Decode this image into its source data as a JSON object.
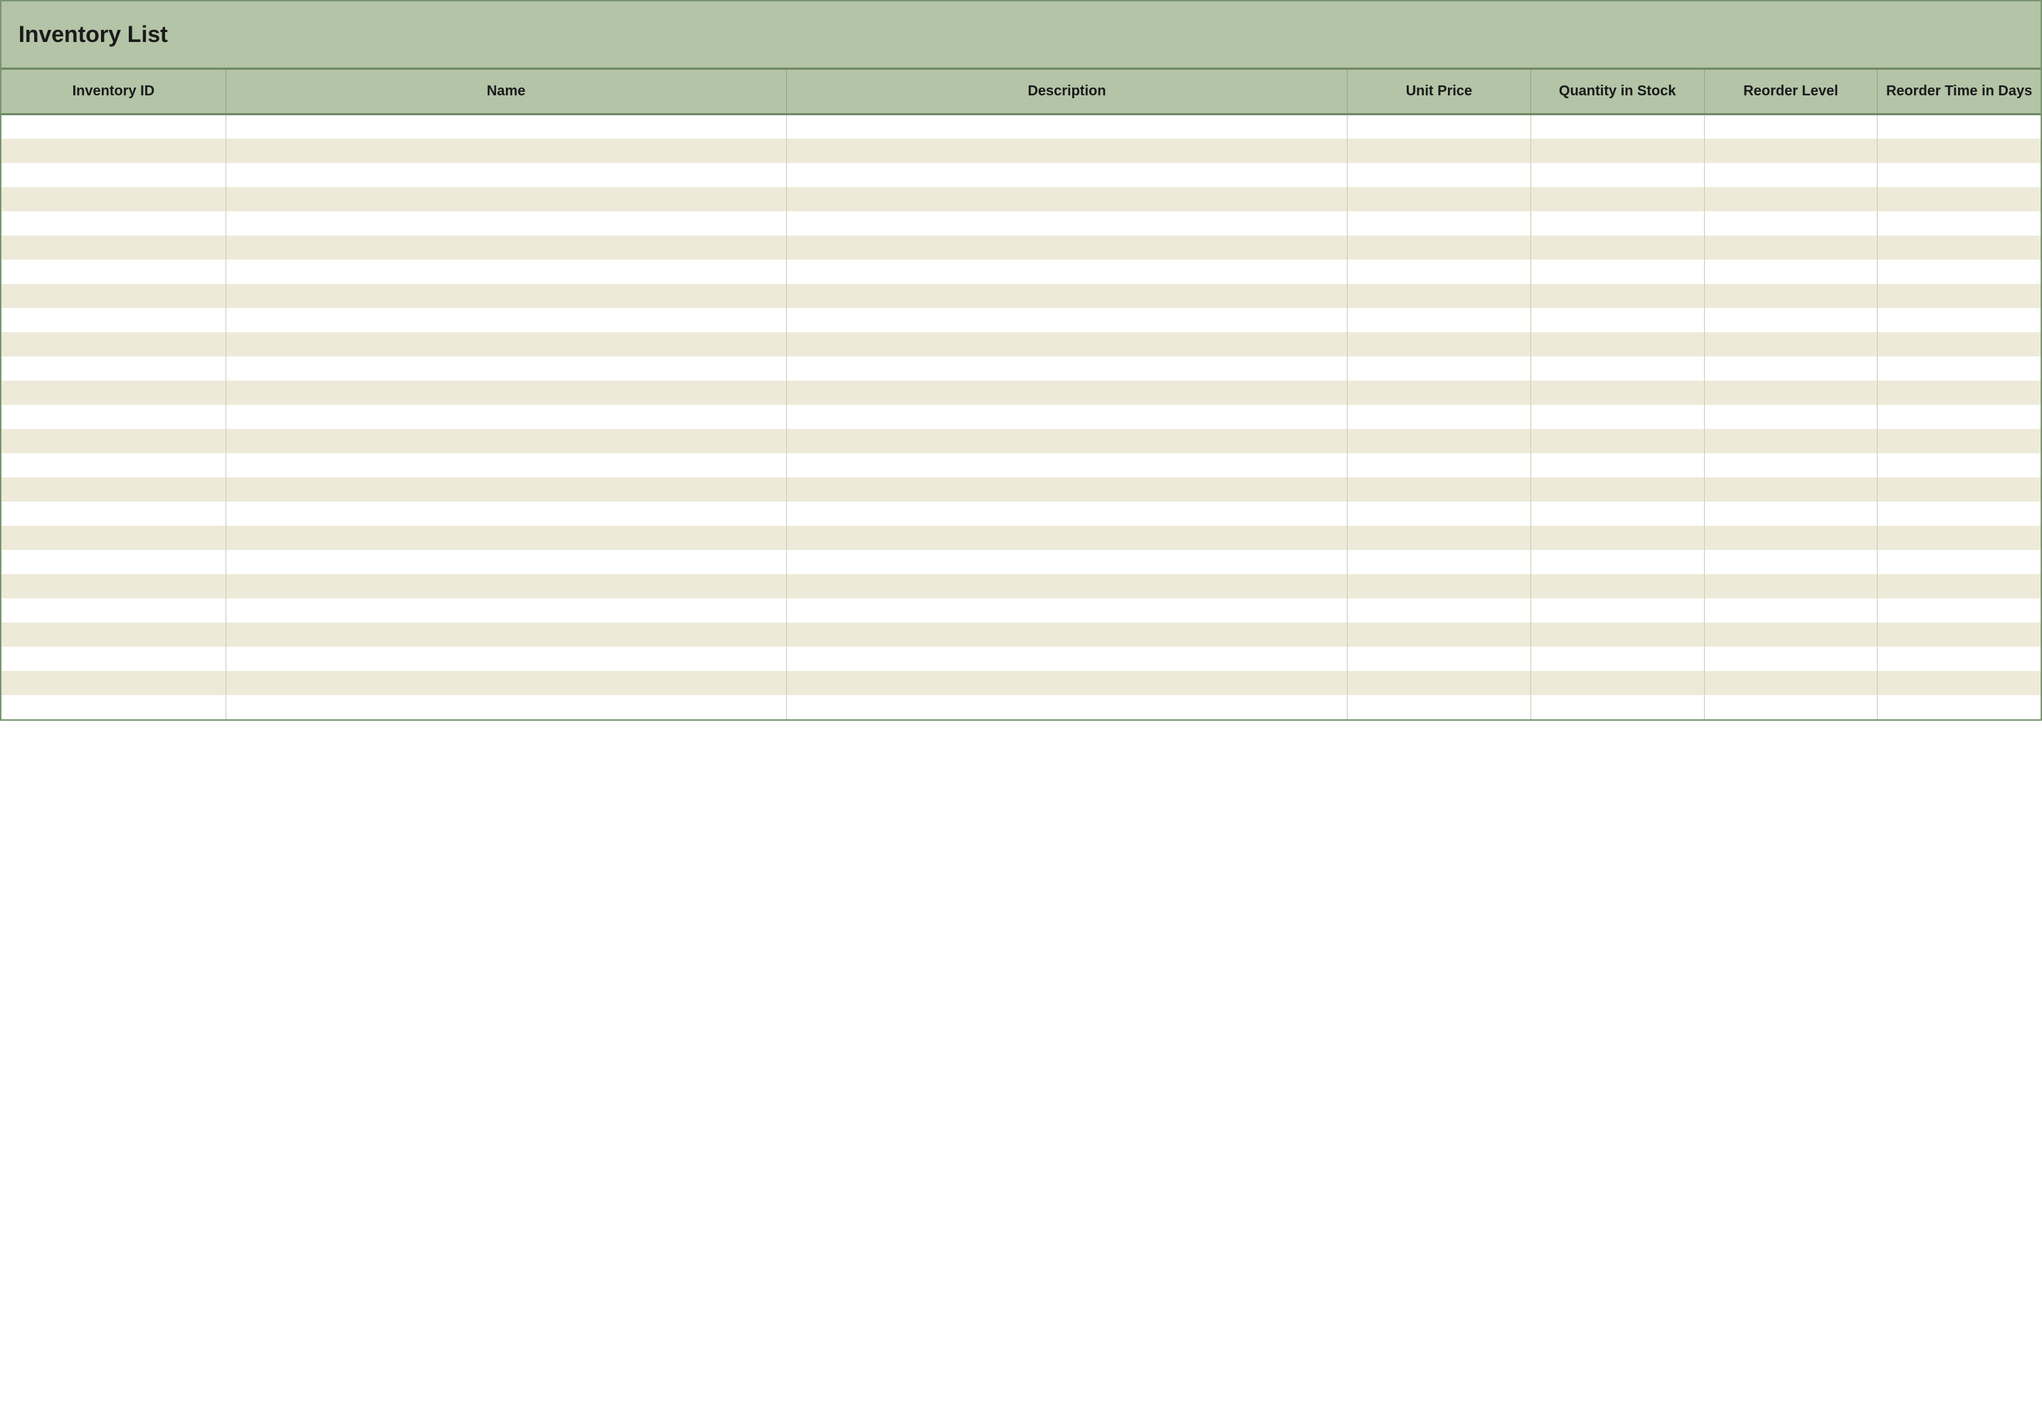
{
  "title": "Inventory List",
  "columns": [
    "Inventory ID",
    "Name",
    "Description",
    "Unit Price",
    "Quantity in Stock",
    "Reorder Level",
    "Reorder Time in Days"
  ],
  "rows": [
    {
      "inventory_id": "",
      "name": "",
      "description": "",
      "unit_price": "",
      "quantity_in_stock": "",
      "reorder_level": "",
      "reorder_time_in_days": ""
    },
    {
      "inventory_id": "",
      "name": "",
      "description": "",
      "unit_price": "",
      "quantity_in_stock": "",
      "reorder_level": "",
      "reorder_time_in_days": ""
    },
    {
      "inventory_id": "",
      "name": "",
      "description": "",
      "unit_price": "",
      "quantity_in_stock": "",
      "reorder_level": "",
      "reorder_time_in_days": ""
    },
    {
      "inventory_id": "",
      "name": "",
      "description": "",
      "unit_price": "",
      "quantity_in_stock": "",
      "reorder_level": "",
      "reorder_time_in_days": ""
    },
    {
      "inventory_id": "",
      "name": "",
      "description": "",
      "unit_price": "",
      "quantity_in_stock": "",
      "reorder_level": "",
      "reorder_time_in_days": ""
    },
    {
      "inventory_id": "",
      "name": "",
      "description": "",
      "unit_price": "",
      "quantity_in_stock": "",
      "reorder_level": "",
      "reorder_time_in_days": ""
    },
    {
      "inventory_id": "",
      "name": "",
      "description": "",
      "unit_price": "",
      "quantity_in_stock": "",
      "reorder_level": "",
      "reorder_time_in_days": ""
    },
    {
      "inventory_id": "",
      "name": "",
      "description": "",
      "unit_price": "",
      "quantity_in_stock": "",
      "reorder_level": "",
      "reorder_time_in_days": ""
    },
    {
      "inventory_id": "",
      "name": "",
      "description": "",
      "unit_price": "",
      "quantity_in_stock": "",
      "reorder_level": "",
      "reorder_time_in_days": ""
    },
    {
      "inventory_id": "",
      "name": "",
      "description": "",
      "unit_price": "",
      "quantity_in_stock": "",
      "reorder_level": "",
      "reorder_time_in_days": ""
    },
    {
      "inventory_id": "",
      "name": "",
      "description": "",
      "unit_price": "",
      "quantity_in_stock": "",
      "reorder_level": "",
      "reorder_time_in_days": ""
    },
    {
      "inventory_id": "",
      "name": "",
      "description": "",
      "unit_price": "",
      "quantity_in_stock": "",
      "reorder_level": "",
      "reorder_time_in_days": ""
    },
    {
      "inventory_id": "",
      "name": "",
      "description": "",
      "unit_price": "",
      "quantity_in_stock": "",
      "reorder_level": "",
      "reorder_time_in_days": ""
    },
    {
      "inventory_id": "",
      "name": "",
      "description": "",
      "unit_price": "",
      "quantity_in_stock": "",
      "reorder_level": "",
      "reorder_time_in_days": ""
    },
    {
      "inventory_id": "",
      "name": "",
      "description": "",
      "unit_price": "",
      "quantity_in_stock": "",
      "reorder_level": "",
      "reorder_time_in_days": ""
    },
    {
      "inventory_id": "",
      "name": "",
      "description": "",
      "unit_price": "",
      "quantity_in_stock": "",
      "reorder_level": "",
      "reorder_time_in_days": ""
    },
    {
      "inventory_id": "",
      "name": "",
      "description": "",
      "unit_price": "",
      "quantity_in_stock": "",
      "reorder_level": "",
      "reorder_time_in_days": ""
    },
    {
      "inventory_id": "",
      "name": "",
      "description": "",
      "unit_price": "",
      "quantity_in_stock": "",
      "reorder_level": "",
      "reorder_time_in_days": ""
    },
    {
      "inventory_id": "",
      "name": "",
      "description": "",
      "unit_price": "",
      "quantity_in_stock": "",
      "reorder_level": "",
      "reorder_time_in_days": ""
    },
    {
      "inventory_id": "",
      "name": "",
      "description": "",
      "unit_price": "",
      "quantity_in_stock": "",
      "reorder_level": "",
      "reorder_time_in_days": ""
    },
    {
      "inventory_id": "",
      "name": "",
      "description": "",
      "unit_price": "",
      "quantity_in_stock": "",
      "reorder_level": "",
      "reorder_time_in_days": ""
    },
    {
      "inventory_id": "",
      "name": "",
      "description": "",
      "unit_price": "",
      "quantity_in_stock": "",
      "reorder_level": "",
      "reorder_time_in_days": ""
    },
    {
      "inventory_id": "",
      "name": "",
      "description": "",
      "unit_price": "",
      "quantity_in_stock": "",
      "reorder_level": "",
      "reorder_time_in_days": ""
    },
    {
      "inventory_id": "",
      "name": "",
      "description": "",
      "unit_price": "",
      "quantity_in_stock": "",
      "reorder_level": "",
      "reorder_time_in_days": ""
    },
    {
      "inventory_id": "",
      "name": "",
      "description": "",
      "unit_price": "",
      "quantity_in_stock": "",
      "reorder_level": "",
      "reorder_time_in_days": ""
    }
  ]
}
